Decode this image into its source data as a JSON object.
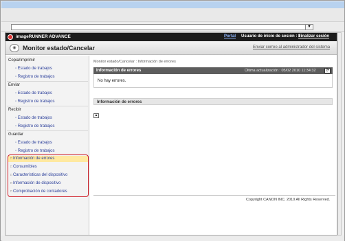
{
  "browser": {
    "address_dropdown_glyph": "▼",
    "scroll_up_glyph": "▲"
  },
  "header": {
    "brand": "imageRUNNER ADVANCE",
    "portal": "Portal",
    "user_info": "Usuario de inicio de sesión : 1",
    "logout": "Finalizar sesión"
  },
  "page": {
    "title": "Monitor estado/Cancelar",
    "email_admin": "Enviar correo al administrador del sistema"
  },
  "sidebar": {
    "sections": [
      {
        "label": "Copia/Imprimir",
        "items": [
          "Estado de trabajos",
          "Registro de trabajos"
        ]
      },
      {
        "label": "Enviar",
        "items": [
          "Estado de trabajos",
          "Registro de trabajos"
        ]
      },
      {
        "label": "Recibir",
        "items": [
          "Estado de trabajos",
          "Registro de trabajos"
        ]
      },
      {
        "label": "Guardar",
        "items": [
          "Estado de trabajos",
          "Registro de trabajos"
        ]
      }
    ],
    "links": [
      "Información de errores",
      "Consumibles",
      "Características del dispositivo",
      "Información de dispositivo",
      "Comprobación de contadores"
    ],
    "highlight_color": "#d0202a",
    "active_color": "#ffe9a0"
  },
  "main": {
    "breadcrumb": "Monitor estado/Cancelar : Información de errores",
    "panel": {
      "title": "Información de errores",
      "updated": "Última actualización : 05/02 2010 11:34:32",
      "message": "No hay errores."
    },
    "section2_title": "Información de errores",
    "top_glyph": "▲",
    "copyright": "Copyright CANON INC. 2010 All Rights Reserved."
  },
  "colors": {
    "titlebar": "#b8d2ef",
    "appbar": "#1c1c1c",
    "panel_head": "#5d5d5d",
    "link": "#2a3e9a"
  }
}
